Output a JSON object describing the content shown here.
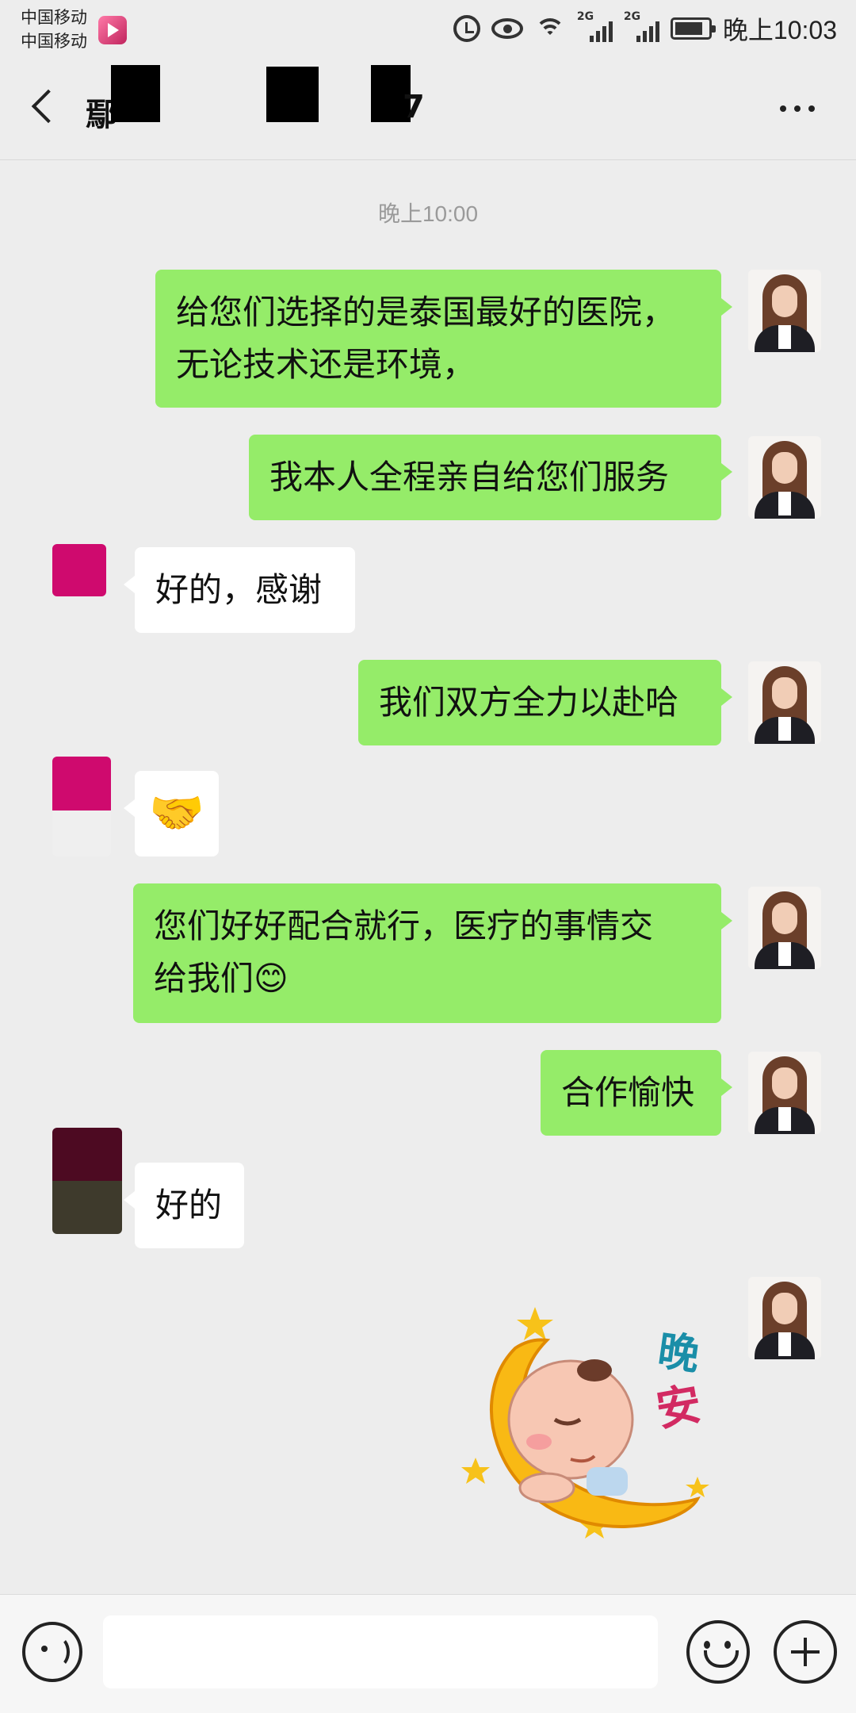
{
  "status_bar": {
    "carrier_1": "中国移动",
    "carrier_2": "中国移动",
    "signal_1_label": "2G",
    "signal_2_label": "2G",
    "time": "晚上10:03",
    "icons": [
      "alarm-icon",
      "eye-icon",
      "wifi-icon",
      "signal-icon",
      "battery-icon"
    ]
  },
  "header": {
    "title": "鄢",
    "title_suffix": "7",
    "back_icon": "chevron-left-icon",
    "more_icon": "more-icon"
  },
  "chat": {
    "timestamp": "晚上10:00",
    "messages": [
      {
        "sender": "me",
        "lines": [
          "给您们选择的是泰国最好的医院，",
          "无论技术还是环境，"
        ]
      },
      {
        "sender": "me",
        "lines": [
          "我本人全程亲自给您们服务"
        ]
      },
      {
        "sender": "other",
        "lines": [
          "好的，感谢"
        ]
      },
      {
        "sender": "me",
        "lines": [
          "我们双方全力以赴哈"
        ]
      },
      {
        "sender": "other",
        "lines": [
          "🤝"
        ]
      },
      {
        "sender": "me",
        "lines": [
          "您们好好配合就行，医疗的事情交",
          "给我们😊"
        ]
      },
      {
        "sender": "me",
        "lines": [
          "合作愉快"
        ]
      },
      {
        "sender": "other",
        "lines": [
          "好的"
        ]
      }
    ],
    "sticker": {
      "text_1": "晚",
      "text_2": "安"
    }
  },
  "input_bar": {
    "placeholder": "",
    "voice_icon": "voice-icon",
    "emoji_icon": "emoji-icon",
    "plus_icon": "plus-icon"
  },
  "colors": {
    "background": "#ededed",
    "bubble_me": "#95ec69",
    "bubble_other": "#ffffff"
  }
}
